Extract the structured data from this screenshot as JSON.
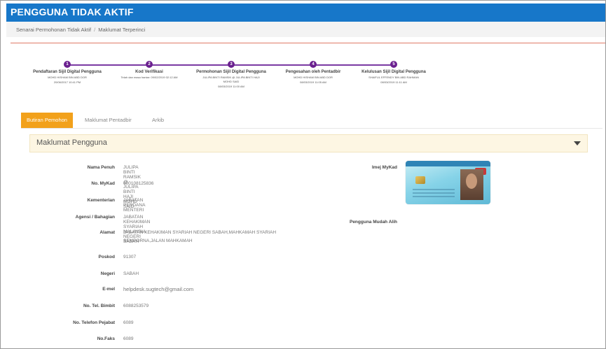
{
  "header": {
    "title": "PENGGUNA TIDAK AKTIF"
  },
  "breadcrumb": {
    "items": [
      "Senarai Permohonan Tidak Aktif",
      "Maklumat Terperinci"
    ],
    "separator": "/"
  },
  "stepper": {
    "steps": [
      {
        "number": "1",
        "title": "Pendaftaran Sijil Digital Pengguna",
        "name": "MOHD HISHAM BIN ABD DOR",
        "date": "20/06/2017 10:41 PM"
      },
      {
        "number": "2",
        "title": "Kod Verifikasi",
        "name": "Telah dan masa hantar: 09/02/2019 02:12 AM",
        "date": ""
      },
      {
        "number": "3",
        "title": "Permohonan Sijil Digital Pengguna",
        "name": "JULIPA BINTI RAMSIK @ JULIPA BINTI HAJI MOHD SAID",
        "date": "08/03/2019 11:00 AM"
      },
      {
        "number": "4",
        "title": "Pengesahan oleh Pentadbir",
        "name": "MOHD HISHAM BIN ABD DOR",
        "date": "08/03/2019 11:05 AM"
      },
      {
        "number": "5",
        "title": "Kelulusan Sijil Digital Pengguna",
        "name": "SHAIFUL EFFENDY BIN ABD RAHMAN",
        "date": "08/03/2019 11:11 AM"
      }
    ]
  },
  "tabs": [
    "Butiran Pemohon",
    "Maklumat Pentadbir",
    "Arkib"
  ],
  "panel": {
    "title": "Maklumat Pengguna"
  },
  "fields": {
    "nama_penuh": {
      "label": "Nama Penuh",
      "value": "JULIPA BINTI RAMSIK @ JULIPA BINTI HAJI MOHD SAID"
    },
    "no_mykad": {
      "label": "No. MyKad",
      "value": "600108125836"
    },
    "kementerian": {
      "label": "Kementerian",
      "value": "JABATAN PERDANA MENTERI"
    },
    "agensi": {
      "label": "Agensi / Bahagian",
      "value": "JABATAN KEHAKIMAN SYARIAH MALAYSIA NEGERI SABAH"
    },
    "alamat": {
      "label": "Alamat",
      "value_line1": "JABATAN KEHAKIMAN SYARIAH NEGERI SABAH,MAHKAMAH SYARIAH",
      "value_line2": "SEMPORNA,JALAN MAHKAMAH"
    },
    "poskod": {
      "label": "Poskod",
      "value": "91307"
    },
    "negeri": {
      "label": "Negeri",
      "value": "SABAH"
    },
    "emel": {
      "label": "E-mel",
      "value": "helpdesk.sugtech@gmail.com"
    },
    "tel_bimbit": {
      "label": "No. Tel. Bimbit",
      "value": "6088253579"
    },
    "tel_pejabat": {
      "label": "No. Telefon Pejabat",
      "value": "6089"
    },
    "faks": {
      "label": "No.Faks",
      "value": "6089"
    }
  },
  "right_fields": {
    "imej_mykad": {
      "label": "Imej MyKad"
    },
    "pengguna_mudah_alih": {
      "label": "Pengguna Mudah Alih"
    }
  },
  "colors": {
    "header_blue": "#1777c9",
    "tab_active": "#f2a11b",
    "stepper_purple": "#6a1f8f",
    "panel_bg": "#fdf6e3"
  }
}
